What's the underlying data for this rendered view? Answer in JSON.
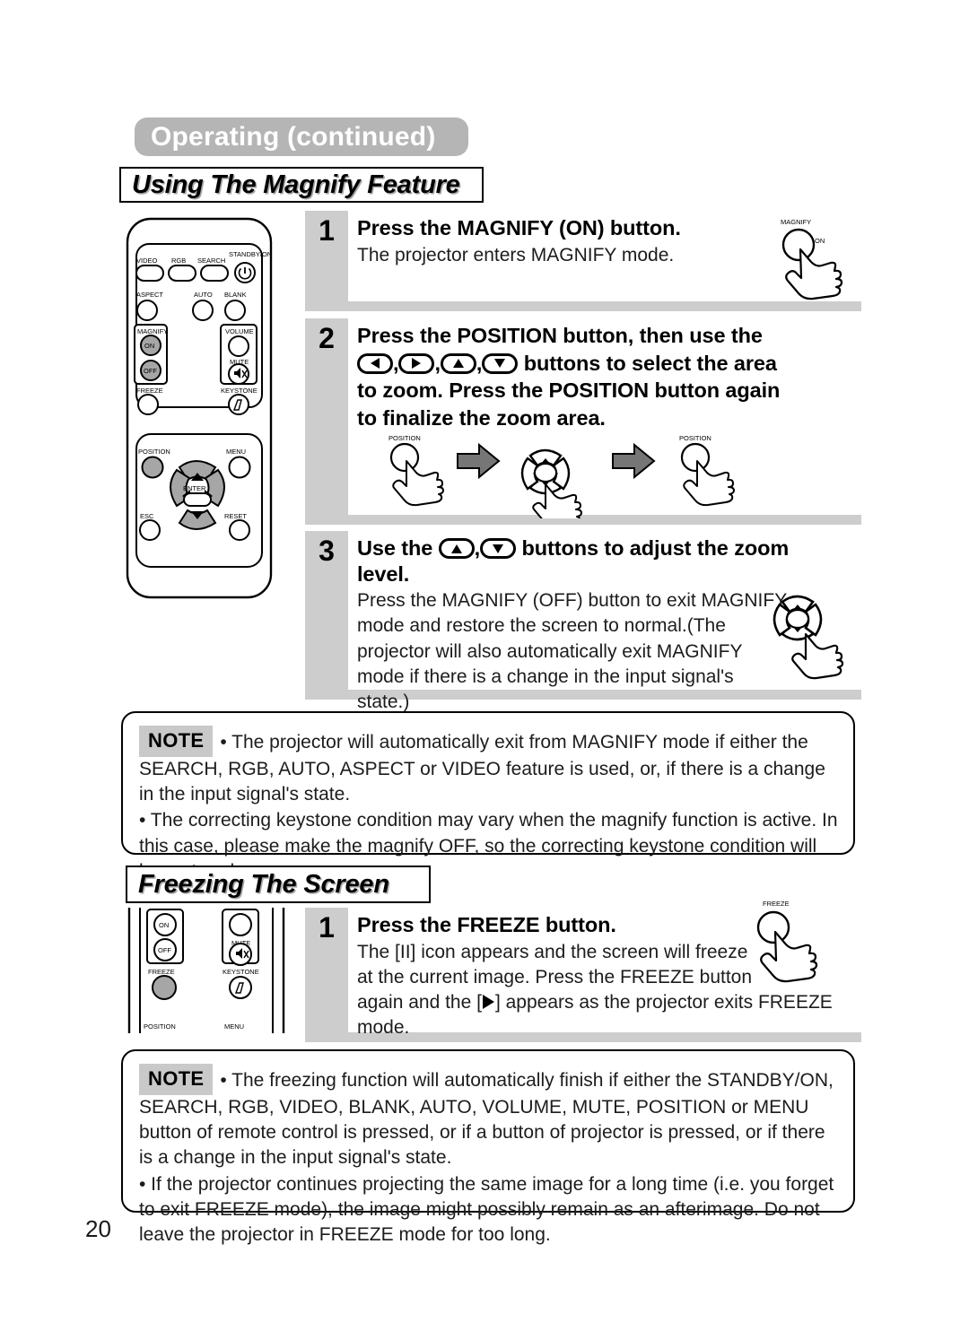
{
  "page": {
    "chapter_title": "Operating (continued)",
    "page_number": "20"
  },
  "sections": [
    {
      "id": "magnify",
      "title": "Using The Magnify Feature"
    },
    {
      "id": "freeze",
      "title": "Freezing The Screen"
    }
  ],
  "magnify_steps": [
    {
      "number": "1",
      "heading": "Press the MAGNIFY (ON) button.",
      "body": "The projector enters MAGNIFY mode.",
      "illustration_label": "MAGNIFY",
      "illustration_sublabel": "ON"
    },
    {
      "number": "2",
      "heading_part1": "Press the POSITION button, then use the",
      "heading_part2": "buttons to select the area",
      "heading_part3": "to zoom. Press the POSITION button again",
      "heading_part4": "to finalize the zoom area.",
      "keys": [
        "left-arrow",
        "right-arrow",
        "up-arrow",
        "down-arrow"
      ],
      "illustration_labels": [
        "POSITION",
        "POSITION"
      ]
    },
    {
      "number": "3",
      "heading_part1": "Use the",
      "heading_part2": "buttons to adjust the zoom",
      "heading_part3": "level.",
      "keys": [
        "up-arrow",
        "down-arrow"
      ],
      "body_lines": [
        "Press the MAGNIFY (OFF) button to exit MAGNIFY",
        "mode and restore the screen to normal.(The",
        "projector will also automatically exit MAGNIFY",
        "mode if there is a change in the input signal's",
        "state.)"
      ]
    }
  ],
  "freeze_steps": [
    {
      "number": "1",
      "heading": "Press the FREEZE button.",
      "body_line1": "The [II] icon appears and the screen will freeze",
      "body_line2": "at the current image. Press the FREEZE button",
      "body_line3_a": "again and the [",
      "body_line3_b": "] appears as the projector exits FREEZE",
      "body_line4": "mode.",
      "illustration_label": "FREEZE"
    }
  ],
  "notes": [
    {
      "badge": "NOTE",
      "paragraphs": [
        "• The projector will automatically exit from MAGNIFY mode if either the SEARCH, RGB, AUTO, ASPECT or VIDEO feature is used, or, if there is a change in the input signal's state.",
        "• The correcting keystone condition may vary when the magnify function is active. In this case, please make the magnify OFF, so the correcting keystone condition will be restored."
      ]
    },
    {
      "badge": "NOTE",
      "paragraphs": [
        "• The freezing function will automatically finish if either the STANDBY/ON, SEARCH, RGB, VIDEO, BLANK, AUTO, VOLUME, MUTE, POSITION or MENU button of remote control is pressed, or if a button of projector is pressed, or if there is a change in the input signal's state.",
        "• If the projector continues projecting the same image for a long time (i.e. you forget to exit FREEZE mode), the image might possibly remain as an afterimage. Do not leave the projector in FREEZE mode for too long."
      ]
    }
  ],
  "remote": {
    "buttons": [
      {
        "label": "VIDEO",
        "shape": "pill",
        "highlight": false
      },
      {
        "label": "RGB",
        "shape": "pill",
        "highlight": false
      },
      {
        "label": "SEARCH",
        "shape": "pill",
        "highlight": false
      },
      {
        "label": "STANDBY/ON",
        "shape": "circle",
        "highlight": false
      },
      {
        "label": "ASPECT",
        "shape": "circle",
        "highlight": false
      },
      {
        "label": "AUTO",
        "shape": "circle",
        "highlight": false
      },
      {
        "label": "BLANK",
        "shape": "circle",
        "highlight": false
      },
      {
        "label": "MAGNIFY",
        "shape": "group",
        "highlight": true
      },
      {
        "label": "ON",
        "shape": "circle",
        "highlight": true
      },
      {
        "label": "OFF",
        "shape": "circle",
        "highlight": true
      },
      {
        "label": "VOLUME",
        "shape": "circle",
        "highlight": false
      },
      {
        "label": "MUTE",
        "shape": "circle",
        "highlight": false
      },
      {
        "label": "FREEZE",
        "shape": "circle",
        "highlight": false
      },
      {
        "label": "KEYSTONE",
        "shape": "circle",
        "highlight": false
      },
      {
        "label": "POSITION",
        "shape": "circle",
        "highlight": true
      },
      {
        "label": "MENU",
        "shape": "circle",
        "highlight": false
      },
      {
        "label": "ENTER",
        "shape": "pill",
        "highlight": false
      },
      {
        "label": "ESC",
        "shape": "circle",
        "highlight": false
      },
      {
        "label": "RESET",
        "shape": "circle",
        "highlight": false
      }
    ]
  },
  "remote_freeze_detail": {
    "buttons": [
      "ON",
      "OFF",
      "FREEZE",
      "MUTE",
      "KEYSTONE",
      "POSITION",
      "MENU"
    ]
  },
  "colors": {
    "chapter_pill_bg": "#b5b5b5",
    "step_bg": "#cdcdcd",
    "note_badge_bg": "#c9c9c9",
    "highlight_button": "#a6a6a6",
    "arrow_fill": "#767676"
  }
}
